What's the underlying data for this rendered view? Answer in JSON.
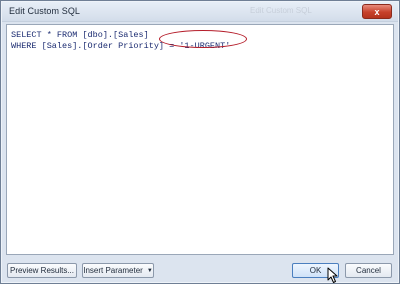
{
  "window": {
    "title": "Edit Custom SQL",
    "close_glyph": "x",
    "background_title": "Edit Custom SQL"
  },
  "editor": {
    "lines": [
      "SELECT * FROM [dbo].[Sales]",
      "WHERE [Sales].[Order Priority] = '1-URGENT'"
    ]
  },
  "buttons": {
    "preview": "Preview Results...",
    "insert_parameter": "Insert Parameter",
    "insert_caret": "▼",
    "ok": "OK",
    "cancel": "Cancel"
  },
  "colors": {
    "highlight_ring": "#b51e2b",
    "sql_text": "#1a2a70",
    "close_button": "#c7412b"
  },
  "icons": {
    "close": "close-icon",
    "dropdown": "chevron-down-icon",
    "cursor": "mouse-pointer-icon"
  }
}
